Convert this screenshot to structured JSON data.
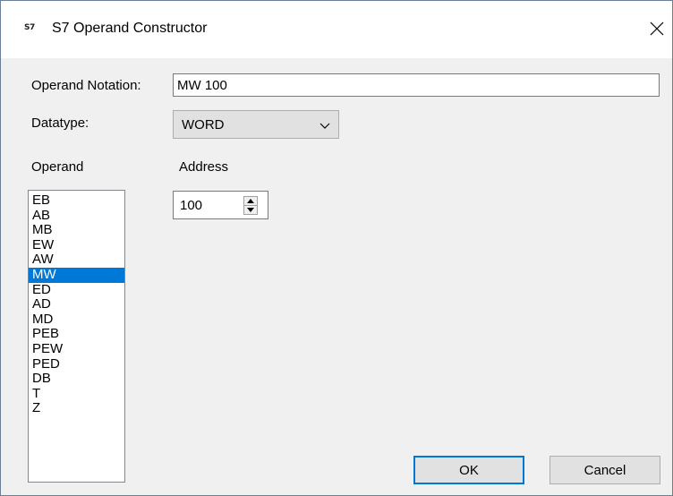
{
  "window": {
    "icon_text": "S7",
    "title": "S7 Operand Constructor",
    "close_icon": "close-icon"
  },
  "form": {
    "notation_label": "Operand Notation:",
    "notation_value": "MW 100",
    "datatype_label": "Datatype:",
    "datatype_value": "WORD",
    "operand_label": "Operand",
    "address_label": "Address",
    "address_value": "100"
  },
  "operands": {
    "items": [
      "EB",
      "AB",
      "MB",
      "EW",
      "AW",
      "MW",
      "ED",
      "AD",
      "MD",
      "PEB",
      "PEW",
      "PED",
      "DB",
      "T",
      "Z"
    ],
    "selected": "MW"
  },
  "buttons": {
    "ok": "OK",
    "cancel": "Cancel"
  },
  "colors": {
    "selection": "#0078d7",
    "default_button_border": "#0078d7",
    "window_bg": "#f0f0f0"
  }
}
